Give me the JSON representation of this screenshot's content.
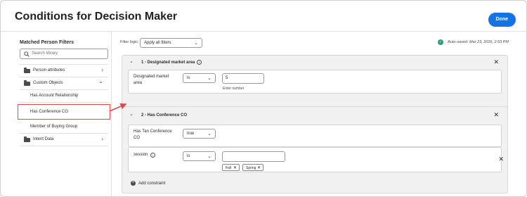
{
  "header": {
    "title": "Conditions for Decision Maker",
    "done_label": "Done"
  },
  "sidebar": {
    "title": "Matched Person Filters",
    "search_placeholder": "Search library",
    "items": [
      {
        "label": "Person attributes",
        "type": "folder",
        "chevron": "›"
      },
      {
        "label": "Custom Objects",
        "type": "folder",
        "chevron": "⌄"
      },
      {
        "label": "Has Account Relationship",
        "type": "sub"
      },
      {
        "label": "Has Conference CO",
        "type": "sub"
      },
      {
        "label": "Member of Buying Group",
        "type": "sub"
      },
      {
        "label": "Intent Data",
        "type": "folder",
        "chevron": "›"
      }
    ]
  },
  "toolbar": {
    "filter_logic_label": "Filter logic:",
    "filter_logic_value": "Apply all filters",
    "autosave": "Auto-saved: Mar 23, 2026, 2:53 PM"
  },
  "groups": [
    {
      "title": "1 - Designated market area",
      "conditions": [
        {
          "label_line1": "Designated market",
          "label_line2": "area",
          "operator": "is",
          "value": "5",
          "help": "Enter number"
        }
      ]
    },
    {
      "title": "2 - Has Conference CO",
      "conditions": [
        {
          "label_line1": "Has Tan Conference",
          "label_line2": "CO",
          "value": "true"
        },
        {
          "label": "session",
          "operator": "is",
          "value": "",
          "tags": [
            "Fall",
            "Spring"
          ]
        }
      ],
      "add_constraint": "Add constraint"
    }
  ],
  "colors": {
    "accent": "#1473e6",
    "highlight": "#e34850",
    "success": "#2d9d78"
  },
  "icons": {
    "check": "✓",
    "close": "✕",
    "chevron_down": "⌄",
    "chevron_right": "›",
    "info": "i",
    "plus": "+"
  }
}
